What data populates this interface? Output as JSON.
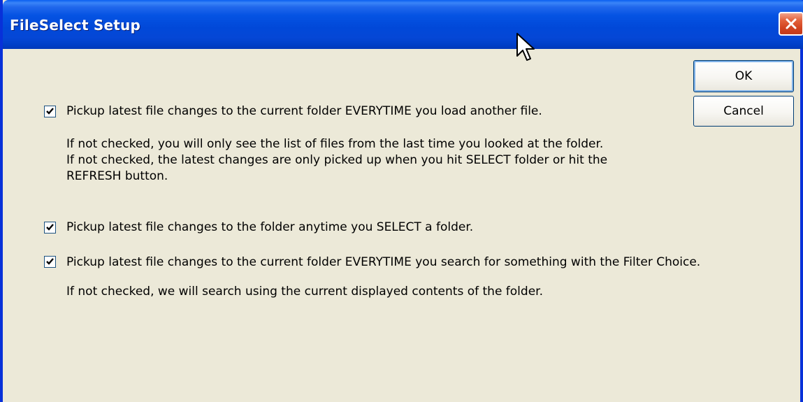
{
  "window": {
    "title": "FileSelect Setup"
  },
  "buttons": {
    "ok_label": "OK",
    "cancel_label": "Cancel"
  },
  "options": [
    {
      "checked": true,
      "label": "Pickup latest file changes to the current folder EVERYTIME you load another file.",
      "notes": [
        "If not checked, you will only see the list of files from  the last time you looked at the folder.",
        "If not checked, the latest changes are only picked up when you hit SELECT folder or hit the",
        "REFRESH button."
      ]
    },
    {
      "checked": true,
      "label": "Pickup latest file changes to the folder anytime you SELECT a folder.",
      "notes": []
    },
    {
      "checked": true,
      "label": "Pickup latest file changes to the current folder EVERYTIME you search for something with the Filter Choice.",
      "notes": [
        "If not checked, we will search using the current displayed contents of the folder."
      ]
    }
  ],
  "colors": {
    "titlebar": "#0553e3",
    "dialog_bg": "#ece9d8",
    "close_button": "#d2431f"
  }
}
